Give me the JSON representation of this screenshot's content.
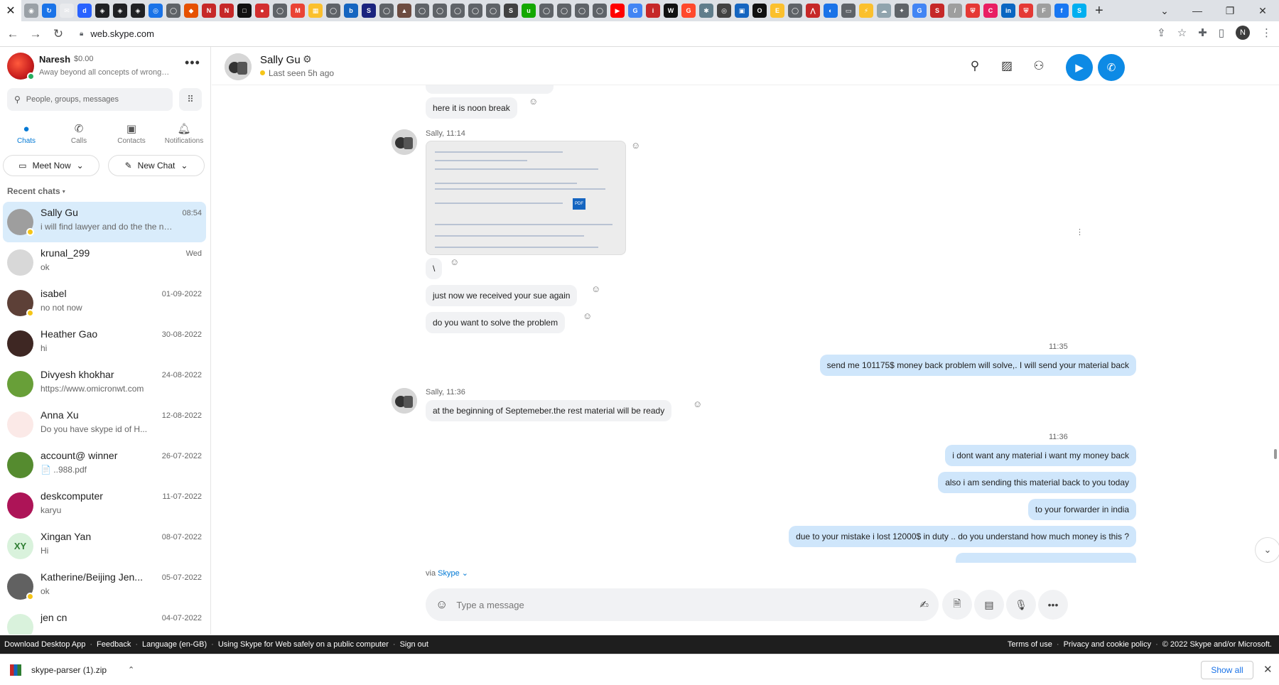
{
  "browser": {
    "tab_close": "✕",
    "new_tab": "+",
    "url": "web.skype.com",
    "profile_initial": "N",
    "favicons": [
      {
        "name": "chrome-icon",
        "color": "#9aa0a6",
        "glyph": "◉"
      },
      {
        "name": "refresh-tab-icon",
        "color": "#1a73e8",
        "glyph": "↻"
      },
      {
        "name": "mail-icon",
        "color": "#e8eaed",
        "glyph": "✉"
      },
      {
        "name": "doc-icon",
        "color": "#2962ff",
        "glyph": "d"
      },
      {
        "name": "block-icon",
        "color": "#202124",
        "glyph": "◈"
      },
      {
        "name": "block-icon",
        "color": "#202124",
        "glyph": "◈"
      },
      {
        "name": "block-icon",
        "color": "#202124",
        "glyph": "◈"
      },
      {
        "name": "compass-icon",
        "color": "#1a73e8",
        "glyph": "◎"
      },
      {
        "name": "globe-icon",
        "color": "#5f6368",
        "glyph": "◯"
      },
      {
        "name": "shop-icon",
        "color": "#e65100",
        "glyph": "◆"
      },
      {
        "name": "news-icon",
        "color": "#c62828",
        "glyph": "N"
      },
      {
        "name": "news-icon",
        "color": "#c62828",
        "glyph": "N"
      },
      {
        "name": "square-icon",
        "color": "#111111",
        "glyph": "□"
      },
      {
        "name": "pills-icon",
        "color": "#d32f2f",
        "glyph": "●"
      },
      {
        "name": "globe-icon",
        "color": "#5f6368",
        "glyph": "◯"
      },
      {
        "name": "gmail-icon",
        "color": "#ea4335",
        "glyph": "M"
      },
      {
        "name": "grid-icon",
        "color": "#fbc02d",
        "glyph": "▦"
      },
      {
        "name": "globe-icon",
        "color": "#5f6368",
        "glyph": "◯"
      },
      {
        "name": "brand-icon",
        "color": "#1565c0",
        "glyph": "b"
      },
      {
        "name": "sai-icon",
        "color": "#1a237e",
        "glyph": "S"
      },
      {
        "name": "globe-icon",
        "color": "#5f6368",
        "glyph": "◯"
      },
      {
        "name": "hat-icon",
        "color": "#6d4c41",
        "glyph": "▲"
      },
      {
        "name": "globe-icon",
        "color": "#5f6368",
        "glyph": "◯"
      },
      {
        "name": "globe-icon",
        "color": "#5f6368",
        "glyph": "◯"
      },
      {
        "name": "globe-icon",
        "color": "#5f6368",
        "glyph": "◯"
      },
      {
        "name": "globe-icon",
        "color": "#5f6368",
        "glyph": "◯"
      },
      {
        "name": "globe-icon",
        "color": "#5f6368",
        "glyph": "◯"
      },
      {
        "name": "seo-icon",
        "color": "#424242",
        "glyph": "S"
      },
      {
        "name": "upwork-icon",
        "color": "#14a800",
        "glyph": "u"
      },
      {
        "name": "globe-icon",
        "color": "#5f6368",
        "glyph": "◯"
      },
      {
        "name": "globe-icon",
        "color": "#5f6368",
        "glyph": "◯"
      },
      {
        "name": "globe-icon",
        "color": "#5f6368",
        "glyph": "◯"
      },
      {
        "name": "globe-icon",
        "color": "#5f6368",
        "glyph": "◯"
      },
      {
        "name": "youtube-icon",
        "color": "#ff0000",
        "glyph": "▶"
      },
      {
        "name": "google-icon",
        "color": "#4285f4",
        "glyph": "G"
      },
      {
        "name": "iqp-icon",
        "color": "#c62828",
        "glyph": "i"
      },
      {
        "name": "w-icon",
        "color": "#111111",
        "glyph": "W"
      },
      {
        "name": "g2-icon",
        "color": "#ff492c",
        "glyph": "G"
      },
      {
        "name": "star-icon",
        "color": "#607d8b",
        "glyph": "✱"
      },
      {
        "name": "chatgpt-icon",
        "color": "#424242",
        "glyph": "◎"
      },
      {
        "name": "flag-icon",
        "color": "#1565c0",
        "glyph": "▣"
      },
      {
        "name": "o-icon",
        "color": "#111111",
        "glyph": "O"
      },
      {
        "name": "e-icon",
        "color": "#fbc02d",
        "glyph": "E"
      },
      {
        "name": "globe-icon",
        "color": "#5f6368",
        "glyph": "◯"
      },
      {
        "name": "up-icon",
        "color": "#c62828",
        "glyph": "⋀"
      },
      {
        "name": "circle-icon",
        "color": "#1a73e8",
        "glyph": "◐"
      },
      {
        "name": "folder-icon",
        "color": "#5f6368",
        "glyph": "▭"
      },
      {
        "name": "bolt-icon",
        "color": "#fbc02d",
        "glyph": "⚡"
      },
      {
        "name": "cloud-icon",
        "color": "#90a4ae",
        "glyph": "☁"
      },
      {
        "name": "puzzle-icon",
        "color": "#5f6368",
        "glyph": "✦"
      },
      {
        "name": "google-icon",
        "color": "#4285f4",
        "glyph": "G"
      },
      {
        "name": "sos-icon",
        "color": "#c62828",
        "glyph": "S"
      },
      {
        "name": "slash-icon",
        "color": "#9e9e9e",
        "glyph": "/"
      },
      {
        "name": "shield-icon",
        "color": "#e53935",
        "glyph": "⛨"
      },
      {
        "name": "c-icon",
        "color": "#e91e63",
        "glyph": "C"
      },
      {
        "name": "linkedin-icon",
        "color": "#0a66c2",
        "glyph": "in"
      },
      {
        "name": "shield-icon",
        "color": "#e53935",
        "glyph": "⛨"
      },
      {
        "name": "ft-icon",
        "color": "#9e9e9e",
        "glyph": "F"
      },
      {
        "name": "facebook-icon",
        "color": "#1877f2",
        "glyph": "f"
      },
      {
        "name": "skype-tab-icon",
        "color": "#00aff0",
        "glyph": "S"
      }
    ]
  },
  "profile": {
    "name": "Naresh",
    "credit": "$0.00",
    "mood": "Away beyond all concepts of wrongdoing"
  },
  "search": {
    "placeholder": "People, groups, messages"
  },
  "nav": {
    "chats": "Chats",
    "calls": "Calls",
    "contacts": "Contacts",
    "notifications": "Notifications"
  },
  "actions": {
    "meet_now": "Meet Now",
    "new_chat": "New Chat"
  },
  "recent_label": "Recent chats",
  "chats": [
    {
      "name": "Sally Gu",
      "date": "08:54",
      "preview": "i will find lawyer and do the the needful",
      "status": true,
      "avatar_bg": "#9e9e9e",
      "initials": "",
      "active": true
    },
    {
      "name": "krunal_299",
      "date": "Wed",
      "preview": "ok",
      "status": false,
      "avatar_bg": "#d8d8d8",
      "initials": "",
      "active": false
    },
    {
      "name": "isabel",
      "date": "01-09-2022",
      "preview": "no not now",
      "status": true,
      "avatar_bg": "#5d4037",
      "initials": "",
      "active": false
    },
    {
      "name": "Heather Gao",
      "date": "30-08-2022",
      "preview": "hi",
      "status": false,
      "avatar_bg": "#3e2723",
      "initials": "",
      "active": false
    },
    {
      "name": "Divyesh khokhar",
      "date": "24-08-2022",
      "preview": "https://www.omicronwt.com",
      "status": false,
      "avatar_bg": "#689f38",
      "initials": "",
      "active": false
    },
    {
      "name": "Anna Xu",
      "date": "12-08-2022",
      "preview": "Do you have skype id of H...",
      "status": false,
      "avatar_bg": "#fbe9e7",
      "initials": "",
      "active": false
    },
    {
      "name": "account@ winner",
      "date": "26-07-2022",
      "preview": "📄 ..988.pdf",
      "status": false,
      "avatar_bg": "#558b2f",
      "initials": "",
      "active": false
    },
    {
      "name": "deskcomputer",
      "date": "11-07-2022",
      "preview": "karyu",
      "status": false,
      "avatar_bg": "#ad1457",
      "initials": "",
      "active": false
    },
    {
      "name": "Xingan  Yan",
      "date": "08-07-2022",
      "preview": "Hi",
      "status": false,
      "avatar_bg": "#d9f2dc",
      "initials": "XY",
      "active": false
    },
    {
      "name": "Katherine/Beijing Jen...",
      "date": "05-07-2022",
      "preview": "ok",
      "status": true,
      "avatar_bg": "#616161",
      "initials": "",
      "active": false
    },
    {
      "name": "jen cn",
      "date": "04-07-2022",
      "preview": "",
      "status": false,
      "avatar_bg": "#d9f2dc",
      "initials": "",
      "active": false
    }
  ],
  "conversation": {
    "name": "Sally Gu",
    "last_seen": "Last seen 5h ago",
    "messages_in_1": "here it is noon break",
    "meta_1": "Sally, 11:14",
    "backslash": "\\",
    "msg_sue": "just now we received your sue again",
    "msg_solve": "do you want to solve the problem",
    "time_out_1": "11:35",
    "msg_out_1": "send me 101175$ money back problem will solve,. I will send your material back",
    "meta_2": "Sally, 11:36",
    "msg_in_2": "at the beginning of Septemeber.the rest material will be ready",
    "time_out_2": "11:36",
    "msg_out_2": "i dont want any material i want my money back",
    "msg_out_3": "also i am sending this material back to you today",
    "msg_out_4": "to your forwarder in india",
    "msg_out_5": "due to your mistake i lost 12000$ in duty .. do you understand how much money is this ?",
    "pdf_label": "PDF"
  },
  "composer": {
    "via": "via",
    "via_link": "Skype",
    "placeholder": "Type a message"
  },
  "footer": {
    "left": [
      "Download Desktop App",
      "Feedback",
      "Language (en-GB)",
      "Using Skype for Web safely on a public computer",
      "Sign out"
    ],
    "right": [
      "Terms of use",
      "Privacy and cookie policy",
      "© 2022 Skype and/or Microsoft."
    ]
  },
  "download": {
    "file": "skype-parser (1).zip",
    "show_all": "Show all"
  },
  "colors": {
    "accent": "#0078d4",
    "active_chat": "#d9ecfb",
    "outgoing_bubble": "#cfe6fb",
    "incoming_bubble": "#f1f2f4",
    "away_status": "#f5c518"
  }
}
